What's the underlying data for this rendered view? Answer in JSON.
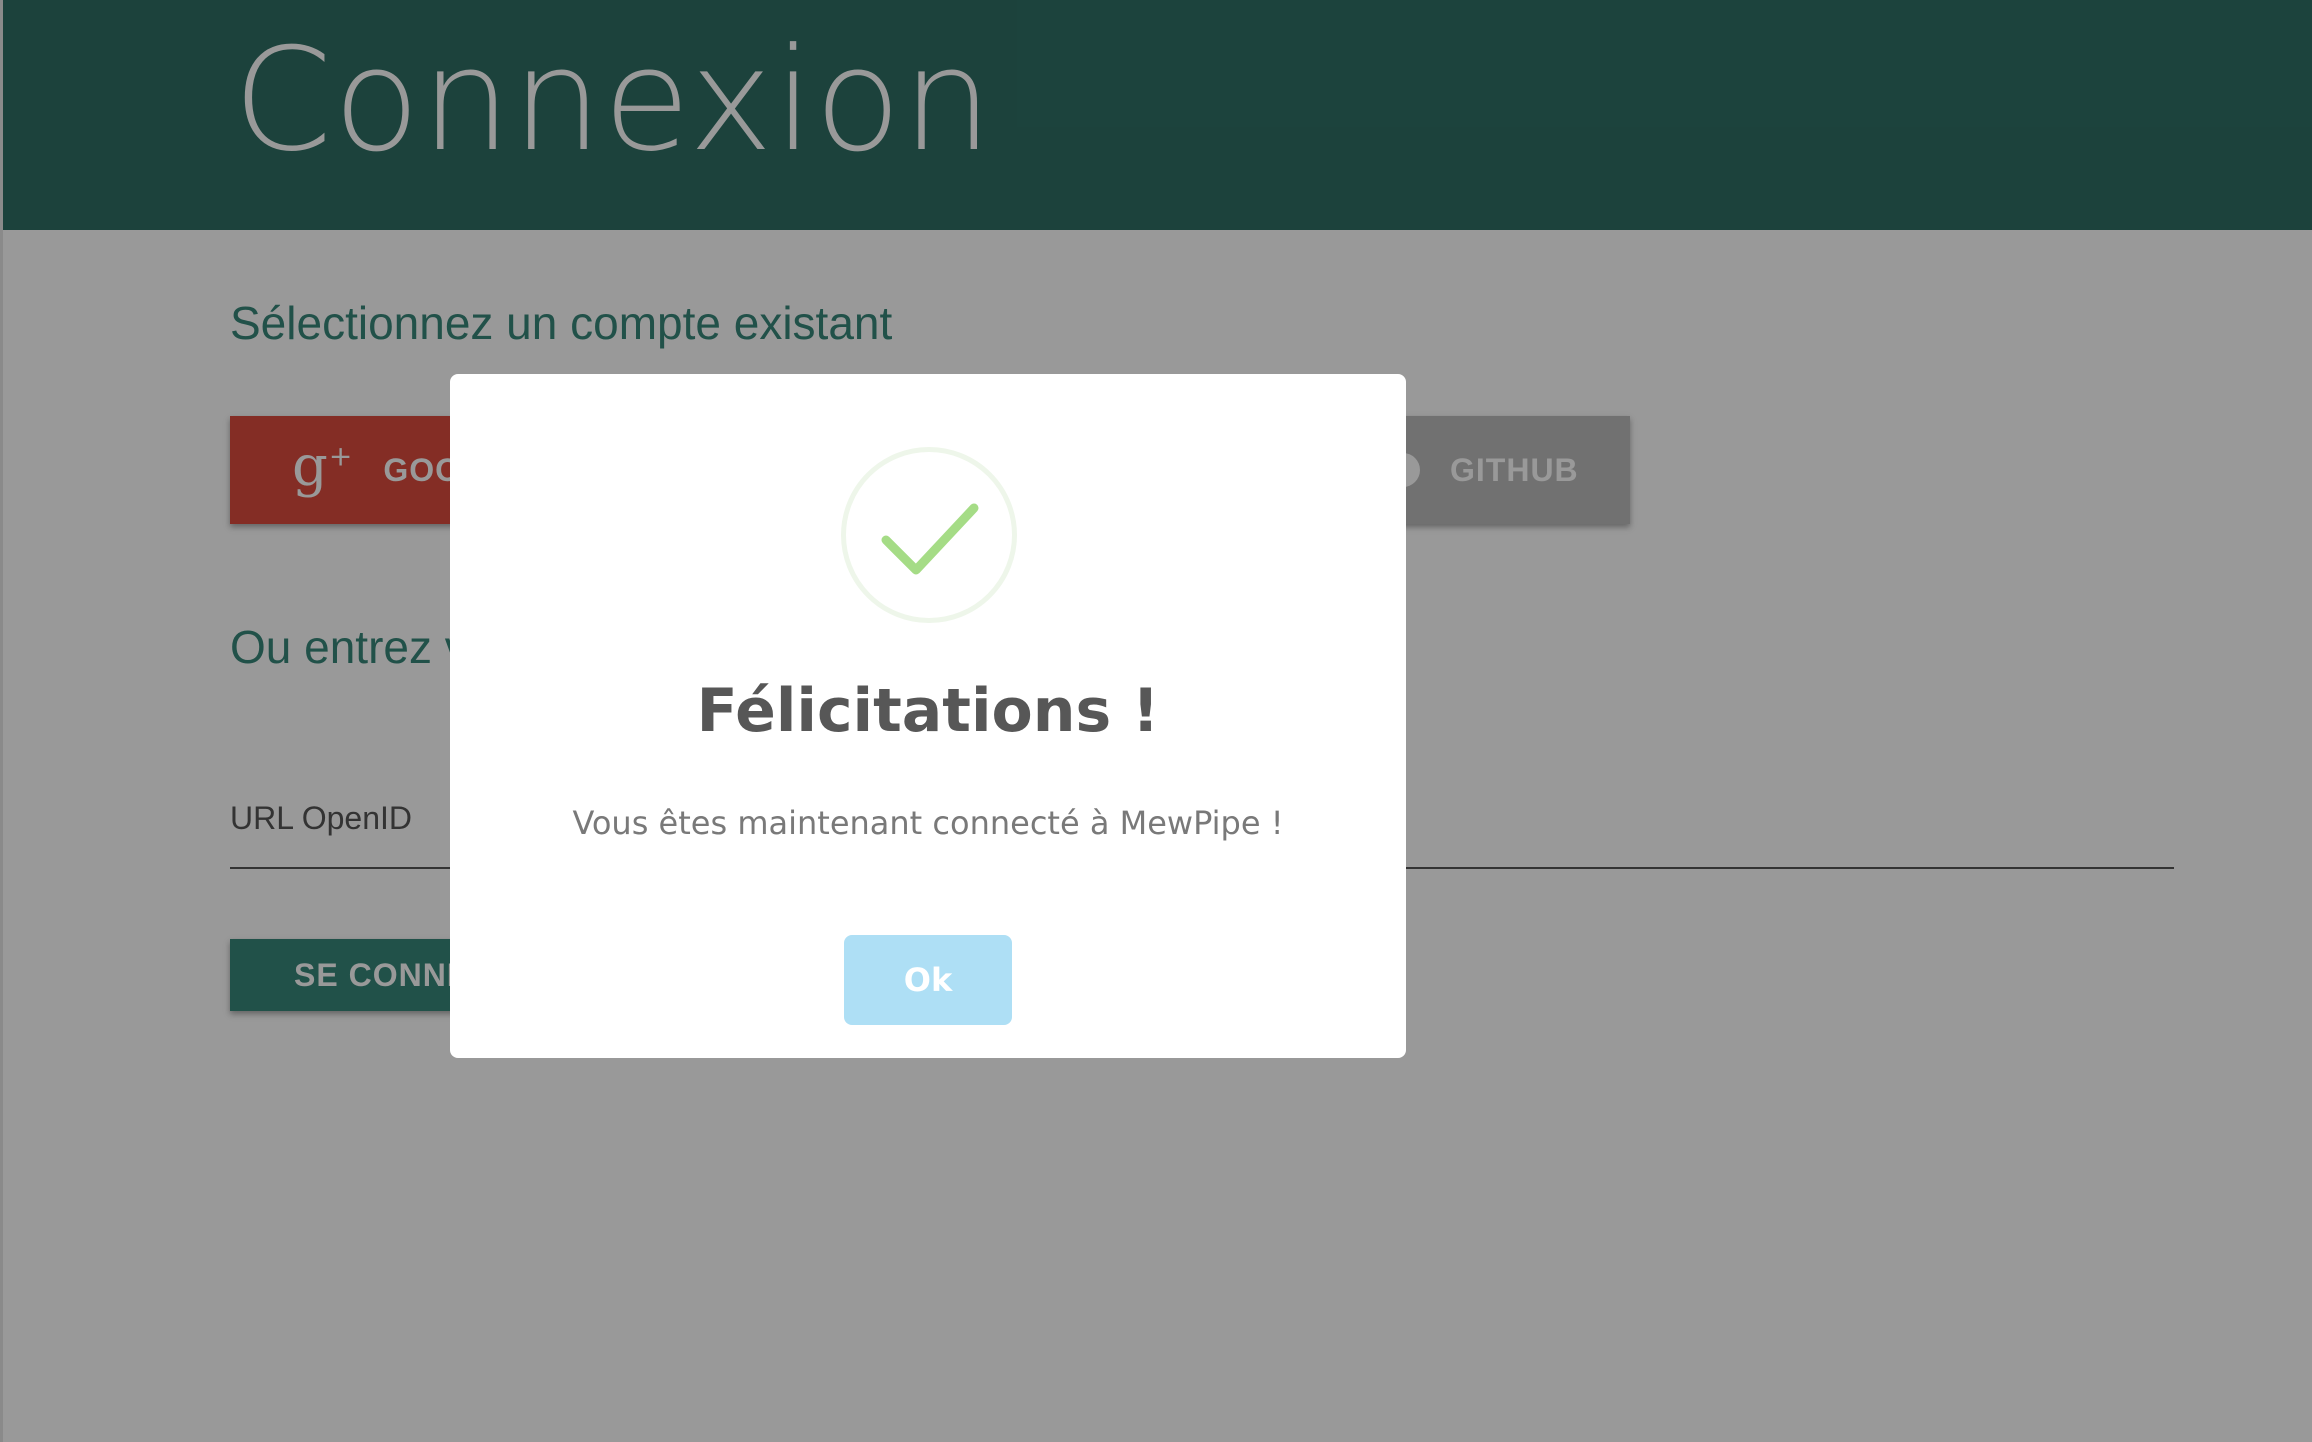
{
  "page": {
    "title": "Connexion",
    "section_existing": "Sélectionnez un compte existant",
    "section_openid": "Ou entrez votre OpenID",
    "buttons": {
      "google_label": "GOOGLE",
      "github_label": "GITHUB",
      "connect_label": "SE CONNECTER"
    },
    "openid_field": {
      "label": "URL OpenID",
      "value": ""
    }
  },
  "dialog": {
    "title": "Félicitations !",
    "message": "Vous êtes maintenant connecté à MewPipe !",
    "ok_label": "Ok",
    "icon": "success-check-icon"
  },
  "colors": {
    "header": "#2f6f65",
    "accent": "#38877a",
    "google": "#dc4b3e",
    "github": "#bdbdbd",
    "ok_button": "#aedff5",
    "check": "#a5dc86"
  }
}
